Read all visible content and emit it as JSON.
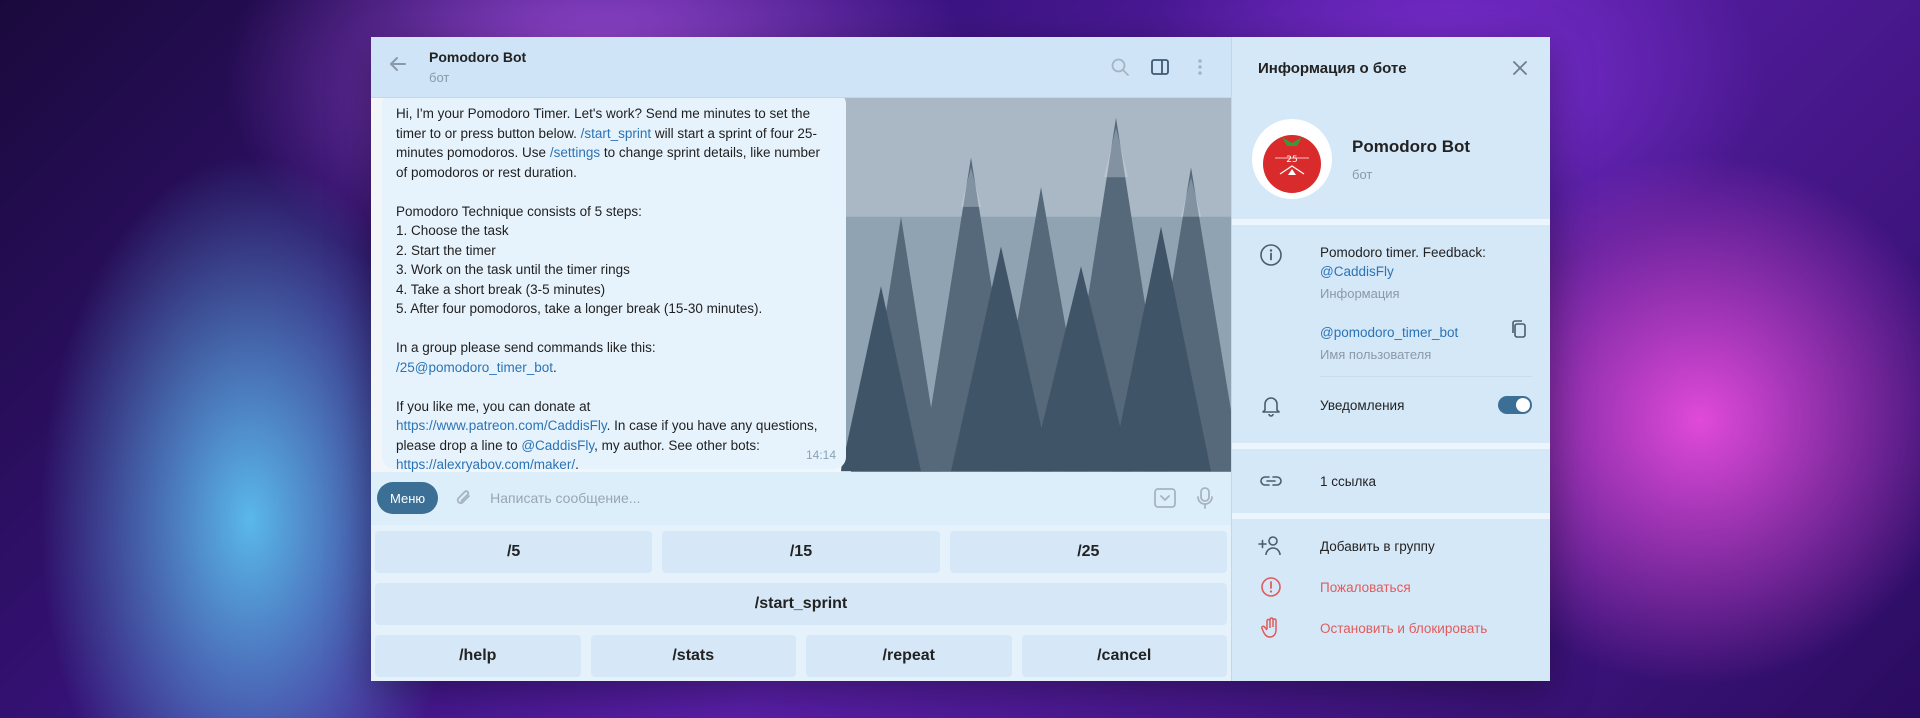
{
  "chat": {
    "title": "Pomodoro Bot",
    "subtitle": "бот",
    "message": {
      "intro_1": "Hi, I'm your Pomodoro Timer. Let's work? Send me minutes to set the timer to or press button below. ",
      "link_start_sprint": "/start_sprint",
      "intro_2": " will start a sprint of four 25-minutes pomodoros. Use ",
      "link_settings": "/settings",
      "intro_3": " to change sprint details, like number of pomodoros or rest duration.\n\nPomodoro Technique consists of 5 steps:\n1. Choose the task\n2. Start the timer\n3. Work on the task until the timer rings\n4. Take a short break (3-5 minutes)\n5. After four pomodoros, take a longer break (15-30 minutes).\n\nIn a group please send commands like this:\n",
      "link_group_cmd": "/25@pomodoro_timer_bot",
      "intro_4": ".\n\nIf you like me, you can donate at\n",
      "link_patreon": "https://www.patreon.com/CaddisFly",
      "intro_5": ".  In case if you have any questions, please drop a line to ",
      "link_author": "@CaddisFly",
      "intro_6": ", my author. See other bots: ",
      "link_maker": "https://alexryabov.com/maker/",
      "intro_7": ".",
      "time": "14:14"
    },
    "composer": {
      "menu_label": "Меню",
      "placeholder": "Написать сообщение..."
    },
    "keyboard": {
      "row1": [
        "/5",
        "/15",
        "/25"
      ],
      "row2": [
        "/start_sprint"
      ],
      "row3": [
        "/help",
        "/stats",
        "/repeat",
        "/cancel"
      ]
    }
  },
  "info_panel": {
    "title": "Информация о боте",
    "name": "Pomodoro Bot",
    "subtitle": "бот",
    "avatar_text": "25",
    "description_text": "Pomodoro timer. Feedback:",
    "description_link": "@CaddisFly",
    "description_label": "Информация",
    "username": "@pomodoro_timer_bot",
    "username_label": "Имя пользователя",
    "notifications_label": "Уведомления",
    "notifications_on": true,
    "links_label": "1 ссылка",
    "add_to_group": "Добавить в группу",
    "report": "Пожаловаться",
    "block": "Остановить и блокировать"
  },
  "colors": {
    "accent": "#3b6f95",
    "link": "#2b73b5",
    "danger": "#e25b5b"
  }
}
